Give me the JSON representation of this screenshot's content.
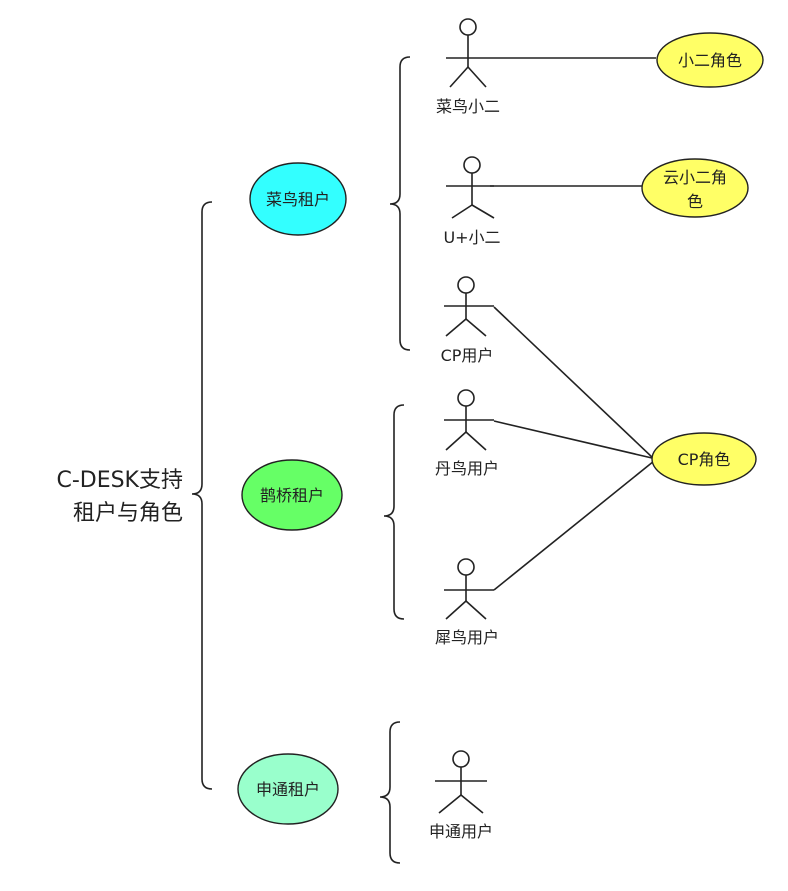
{
  "root": {
    "line1": "C-DESK支持",
    "line2": "租户与角色"
  },
  "tenants": [
    {
      "label": "菜鸟租户",
      "color": "#33ffff"
    },
    {
      "label": "鹊桥租户",
      "color": "#66ff66"
    },
    {
      "label": "申通租户",
      "color": "#99ffcc"
    }
  ],
  "actors": [
    {
      "label": "菜鸟小二"
    },
    {
      "label": "U+小二"
    },
    {
      "label": "CP用户"
    },
    {
      "label": "丹鸟用户"
    },
    {
      "label": "犀鸟用户"
    },
    {
      "label": "申通用户"
    }
  ],
  "roles": [
    {
      "line1": "小二角色",
      "line2": "",
      "color": "#ffff66"
    },
    {
      "line1": "云小二角",
      "line2": "色",
      "color": "#ffff66"
    },
    {
      "line1": "CP角色",
      "line2": "",
      "color": "#ffff66"
    }
  ]
}
